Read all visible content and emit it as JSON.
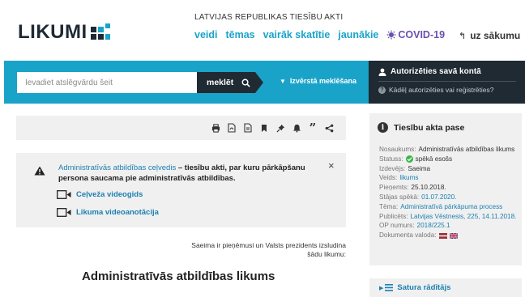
{
  "header": {
    "logo_text": "LIKUMI",
    "tagline": "LATVIJAS REPUBLIKAS TIESĪBU AKTI",
    "nav": [
      "veidi",
      "tēmas",
      "vairāk skatītie",
      "jaunākie"
    ],
    "covid_label": "COVID-19",
    "home_label": "uz sākumu"
  },
  "search": {
    "placeholder": "Ievadiet atslēgvārdu šeit",
    "button_label": "meklēt",
    "advanced_label": "Izvērstā meklēšana"
  },
  "auth": {
    "login_label": "Autorizēties savā kontā",
    "help_label": "Kādēļ autorizēties vai reģistrēties?"
  },
  "toolbar": {
    "icons": [
      "print-icon",
      "pdf-icon",
      "document-icon",
      "bookmark-icon",
      "pin-icon",
      "bell-icon",
      "quote-icon",
      "share-icon"
    ]
  },
  "notice": {
    "link_text": "Administratīvās atbildības ceļvedis",
    "rest_text": " – tiesību akti, par kuru pārkāpšanu persona saucama pie administratīvās atbildības.",
    "close_label": "×",
    "video_links": [
      "Ceļveža videogids",
      "Likuma videoanotācija"
    ]
  },
  "document": {
    "intro": "Saeima ir pieņēmusi un Valsts prezidents izsludina šādu likumu:",
    "title": "Administratīvās atbildības likums"
  },
  "passport": {
    "heading": "Tiesību akta pase",
    "rows": [
      {
        "key": "Nosaukums:",
        "value": "Administratīvās atbildības likums"
      },
      {
        "key": "Statuss:",
        "value": "spēkā esošs"
      },
      {
        "key": "Izdevējs:",
        "value": "Saeima"
      },
      {
        "key": "Veids:",
        "value": "likums"
      },
      {
        "key": "Pieņemts:",
        "value": "25.10.2018."
      },
      {
        "key": "Stājas spēkā:",
        "value": "01.07.2020."
      },
      {
        "key": "Tēma:",
        "value": "Administratīvā pārkāpuma process"
      },
      {
        "key": "Publicēts:",
        "value": "Latvijas Vēstnesis, 225, 14.11.2018."
      },
      {
        "key": "OP numurs:",
        "value": "2018/225.1"
      },
      {
        "key": "Dokumenta valoda:",
        "value": ""
      }
    ],
    "languages": [
      "lv",
      "en"
    ]
  },
  "toc": {
    "label": "Satura rādītājs"
  },
  "colors": {
    "brand": "#1aa3c8",
    "dark": "#1f2a33",
    "link": "#1b7fb0",
    "covid": "#6b4fb0",
    "status_green": "#3ab54a"
  }
}
